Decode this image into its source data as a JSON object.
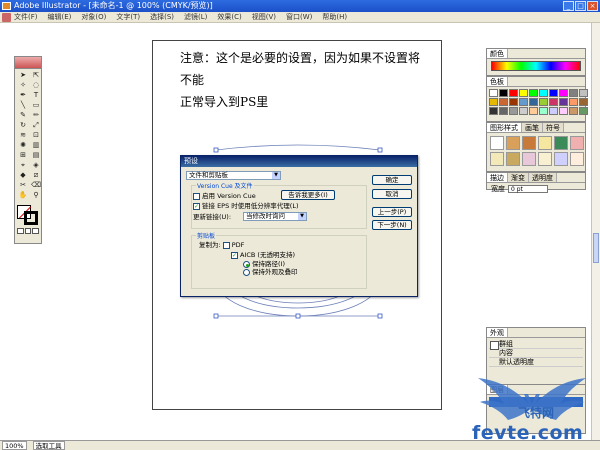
{
  "window": {
    "title": "Adobe Illustrator - [未命名-1 @ 100% (CMYK/预览)]",
    "buttons": [
      "_",
      "□",
      "×"
    ]
  },
  "menubar": [
    "文件(F)",
    "编辑(E)",
    "对象(O)",
    "文字(T)",
    "选择(S)",
    "滤镜(L)",
    "效果(C)",
    "视图(V)",
    "窗口(W)",
    "帮助(H)"
  ],
  "note": {
    "line1": "注意：这个是必要的设置，因为如果不设置将不能",
    "line2": "正常导入到PS里"
  },
  "palettes": {
    "color_title": "颜色",
    "swatches_title": "色板",
    "style_tabs": [
      "图形样式",
      "画笔",
      "符号"
    ],
    "stroke_tabs": [
      "描边",
      "渐变",
      "透明度"
    ],
    "stroke_label": "宽度",
    "stroke_value": "0 pt",
    "appearance_tab": "外观",
    "appearance_rows": [
      "群组",
      "内容",
      "默认透明度"
    ],
    "layers_tab": "图层"
  },
  "swatch_colors": [
    "#ffffff",
    "#000000",
    "#ff0000",
    "#ffff00",
    "#00ff00",
    "#00ffff",
    "#0000ff",
    "#ff00ff",
    "#808080",
    "#c0c0c0",
    "#e6b800",
    "#cc6633",
    "#993300",
    "#6699cc",
    "#336699",
    "#99cc33",
    "#cc3366",
    "#663399",
    "#ff9966",
    "#996633",
    "#333333",
    "#666666",
    "#999999",
    "#cccccc",
    "#ffcc99",
    "#99ffcc",
    "#ccccff",
    "#ffccff",
    "#cc9966",
    "#669966"
  ],
  "dialog": {
    "title": "预设",
    "section_select": "文件和剪贴板",
    "version_cue_label": "Version Cue 及文件",
    "enable_version_cue": "启用 Version Cue",
    "link_eps": "链接 EPS 时使用低分辨率代理(L)",
    "learn_more": "告诉我更多(I)",
    "update_label": "更新链接(U):",
    "update_value": "当修改时询问",
    "clipboard_label": "剪贴板",
    "copy_as": "复制为:",
    "pdf": "PDF",
    "aicb": "AICB (无透明支持)",
    "keep_paths": "保持路径(I)",
    "keep_appearance": "保持外观及叠印",
    "btn_ok": "确定",
    "btn_cancel": "取消",
    "btn_prev": "上一步(P)",
    "btn_next": "下一步(N)"
  },
  "statusbar": {
    "zoom": "100%",
    "tool": "选取工具"
  },
  "watermark": {
    "site": "fevte.com",
    "cn": "飞特网"
  }
}
